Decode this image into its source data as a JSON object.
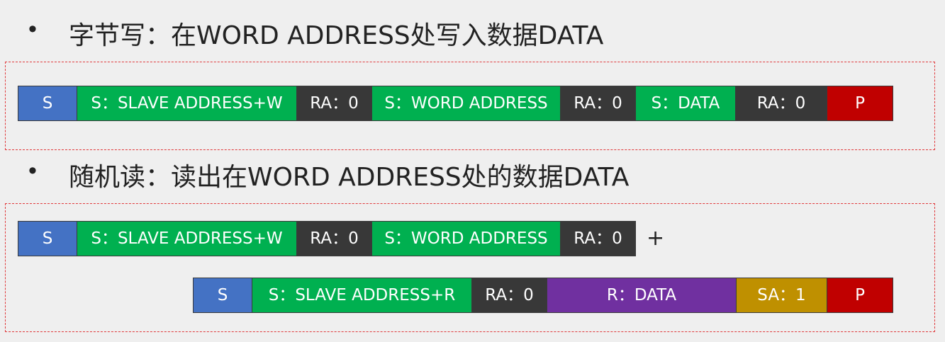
{
  "colors": {
    "start": "#4472c4",
    "send": "#00b050",
    "ack": "#383838",
    "stop": "#c00000",
    "read": "#7030a0",
    "sa": "#bf9000",
    "dash": "#e0393b"
  },
  "bullet_glyph": "•",
  "byte_write": {
    "title": "字节写：在WORD ADDRESS处写入数据DATA",
    "cells": [
      "S",
      "S：SLAVE ADDRESS+W",
      "RA：0",
      "S：WORD ADDRESS",
      "RA：0",
      "S：DATA",
      "RA：0",
      "P"
    ]
  },
  "random_read": {
    "title": "随机读：读出在WORD ADDRESS处的数据DATA",
    "row1_cells": [
      "S",
      "S：SLAVE ADDRESS+W",
      "RA：0",
      "S：WORD ADDRESS",
      "RA：0"
    ],
    "plus": "+",
    "row2_cells": [
      "S",
      "S：SLAVE ADDRESS+R",
      "RA：0",
      "R：DATA",
      "SA：1",
      "P"
    ]
  }
}
